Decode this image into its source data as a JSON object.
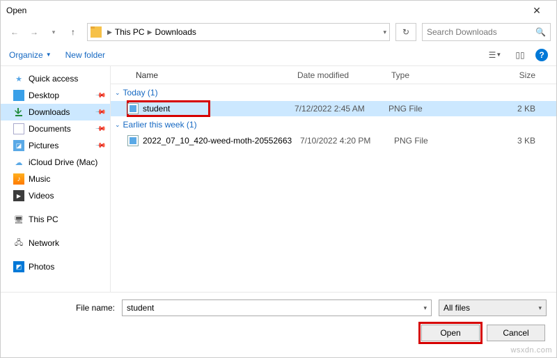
{
  "title": "Open",
  "breadcrumb": {
    "root": "This PC",
    "folder": "Downloads"
  },
  "search": {
    "placeholder": "Search Downloads"
  },
  "toolbar": {
    "organize": "Organize",
    "newfolder": "New folder"
  },
  "sidebar": {
    "quick_access": "Quick access",
    "desktop": "Desktop",
    "downloads": "Downloads",
    "documents": "Documents",
    "pictures": "Pictures",
    "icloud": "iCloud Drive (Mac)",
    "music": "Music",
    "videos": "Videos",
    "this_pc": "This PC",
    "network": "Network",
    "photos": "Photos"
  },
  "columns": {
    "name": "Name",
    "date": "Date modified",
    "type": "Type",
    "size": "Size"
  },
  "groups": {
    "today": {
      "label": "Today (1)",
      "files": [
        {
          "name": "student",
          "date": "7/12/2022 2:45 AM",
          "type": "PNG File",
          "size": "2 KB"
        }
      ]
    },
    "earlier": {
      "label": "Earlier this week (1)",
      "files": [
        {
          "name": "2022_07_10_420-weed-moth-20552663",
          "date": "7/10/2022 4:20 PM",
          "type": "PNG File",
          "size": "3 KB"
        }
      ]
    }
  },
  "footer": {
    "label": "File name:",
    "selected": "student",
    "filter": "All files",
    "open": "Open",
    "cancel": "Cancel"
  },
  "watermark": "wsxdn.com"
}
